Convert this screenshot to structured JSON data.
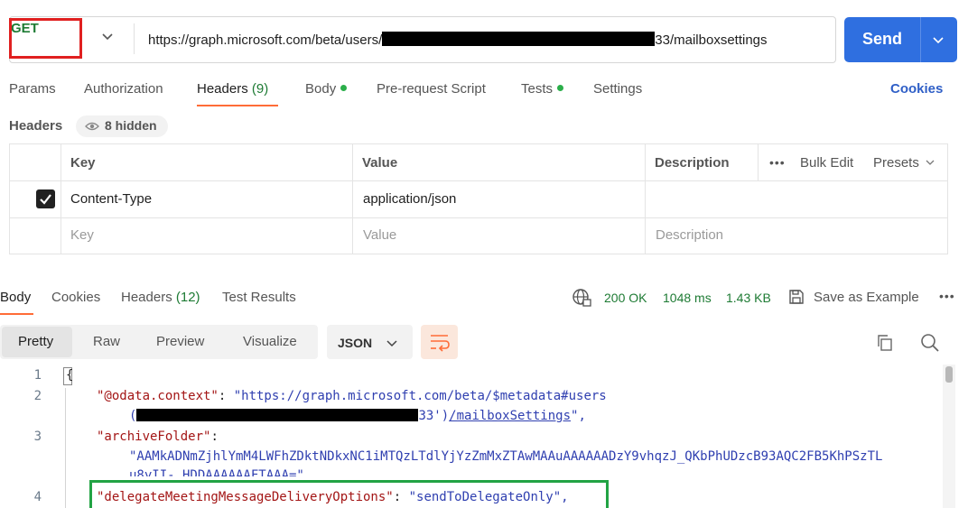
{
  "request": {
    "method": "GET",
    "url_prefix": "https://graph.microsoft.com/beta/users/",
    "url_suffix": "33/mailboxsettings",
    "send_label": "Send"
  },
  "request_tabs": {
    "params": "Params",
    "authorization": "Authorization",
    "headers": "Headers",
    "headers_count": "(9)",
    "body": "Body",
    "prerequest": "Pre-request Script",
    "tests": "Tests",
    "settings": "Settings",
    "cookies": "Cookies"
  },
  "headers_section": {
    "title": "Headers",
    "hidden": "8 hidden",
    "columns": {
      "key": "Key",
      "value": "Value",
      "description": "Description"
    },
    "bulk_edit": "Bulk Edit",
    "presets": "Presets",
    "rows": [
      {
        "checked": true,
        "key": "Content-Type",
        "value": "application/json",
        "description": ""
      }
    ],
    "placeholders": {
      "key": "Key",
      "value": "Value",
      "description": "Description"
    }
  },
  "response_tabs": {
    "body": "Body",
    "cookies": "Cookies",
    "headers": "Headers",
    "headers_count": "(12)",
    "test_results": "Test Results"
  },
  "response_status": {
    "status": "200 OK",
    "time": "1048 ms",
    "size": "1.43 KB",
    "save_example": "Save as Example"
  },
  "view": {
    "modes": [
      "Pretty",
      "Raw",
      "Preview",
      "Visualize"
    ],
    "active": "Pretty",
    "format": "JSON"
  },
  "code": {
    "line_numbers": [
      "1",
      "2",
      "3",
      "4"
    ],
    "l1": "{",
    "l2_key": "\"@odata.context\"",
    "l2_val": "\"https://graph.microsoft.com/beta/$metadata#users",
    "l2b_open": "(",
    "l2b_mid": "33')",
    "l2b_link": "/mailboxSettings",
    "l2b_end": "\",",
    "l3_key": "\"archiveFolder\"",
    "l3_val": "\"AAMkADNmZjhlYmM4LWFhZDktNDkxNC1iMTQzLTdlYjYzZmMxZTAwMAAuAAAAAADzY9vhqzJ_QKbPhUDzcB93AQC2FB5KhPSzTL",
    "l3_cont": "u8yII-_HDDAAAAAAFTAAA=\",",
    "l4_key": "\"delegateMeetingMessageDeliveryOptions\"",
    "l4_val": "\"sendToDelegateOnly\","
  },
  "colors": {
    "accent": "#ff6c37",
    "send": "#2f6fe0",
    "success": "#1e7b34",
    "highlight_red": "#e02020",
    "highlight_green": "#22a344"
  }
}
